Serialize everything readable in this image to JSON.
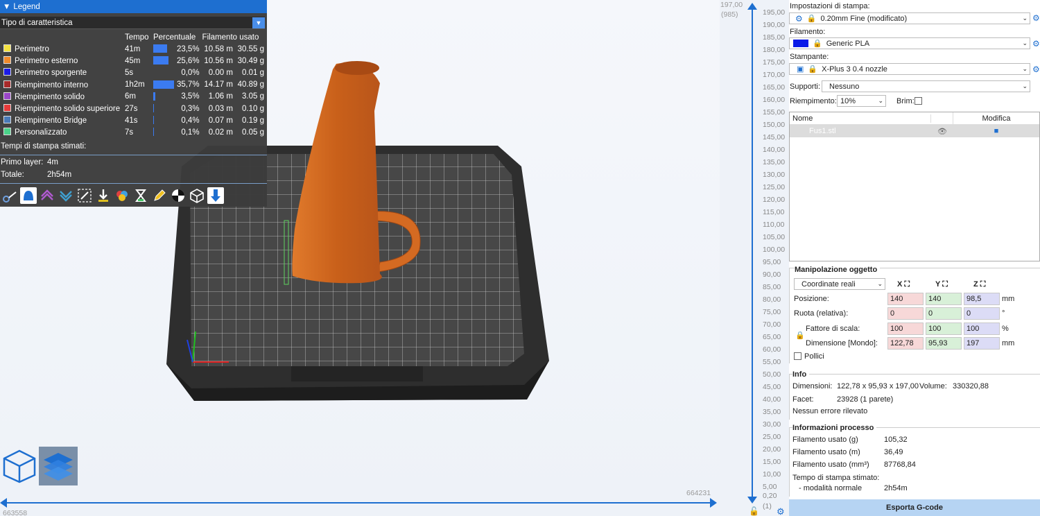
{
  "legend": {
    "title": "Legend",
    "combo": "Tipo di caratteristica",
    "headers": [
      "",
      "Tempo",
      "Percentuale",
      "Filamento usato"
    ],
    "rows": [
      {
        "name": "Perimetro",
        "color": "#f4e241",
        "time": "41m",
        "pct": "23,5%",
        "pct_value": 23.5,
        "m": "10.58 m",
        "g": "30.55 g"
      },
      {
        "name": "Perimetro esterno",
        "color": "#f08a2b",
        "time": "45m",
        "pct": "25,6%",
        "pct_value": 25.6,
        "m": "10.56 m",
        "g": "30.49 g"
      },
      {
        "name": "Perimetro sporgente",
        "color": "#1c1ce6",
        "time": "5s",
        "pct": "0,0%",
        "pct_value": 0,
        "m": "0.00 m",
        "g": "0.01 g"
      },
      {
        "name": "Riempimento interno",
        "color": "#a82a2a",
        "time": "1h2m",
        "pct": "35,7%",
        "pct_value": 35.7,
        "m": "14.17 m",
        "g": "40.89 g"
      },
      {
        "name": "Riempimento solido",
        "color": "#9a46c8",
        "time": "6m",
        "pct": "3,5%",
        "pct_value": 3.5,
        "m": "1.06 m",
        "g": "3.05 g"
      },
      {
        "name": "Riempimento solido superiore",
        "color": "#e63a3a",
        "time": "27s",
        "pct": "0,3%",
        "pct_value": 0.3,
        "m": "0.03 m",
        "g": "0.10 g"
      },
      {
        "name": "Riempimento Bridge",
        "color": "#4a7ab8",
        "time": "41s",
        "pct": "0,4%",
        "pct_value": 0.4,
        "m": "0.07 m",
        "g": "0.19 g"
      },
      {
        "name": "Personalizzato",
        "color": "#4bd38a",
        "time": "7s",
        "pct": "0,1%",
        "pct_value": 0.1,
        "m": "0.02 m",
        "g": "0.05 g"
      }
    ],
    "times_title": "Tempi di stampa stimati:",
    "first_layer_label": "Primo layer:",
    "first_layer": "4m",
    "total_label": "Totale:",
    "total": "2h54m"
  },
  "viewport": {
    "top_left_value": "197,00",
    "top_left_sub": "(985)",
    "bottom_left": "663558",
    "bottom_right": "664231"
  },
  "ruler": {
    "ticks": [
      "195,00",
      "190,00",
      "185,00",
      "180,00",
      "175,00",
      "170,00",
      "165,00",
      "160,00",
      "155,00",
      "150,00",
      "145,00",
      "140,00",
      "135,00",
      "130,00",
      "125,00",
      "120,00",
      "115,00",
      "110,00",
      "105,00",
      "100,00",
      "95,00",
      "90,00",
      "85,00",
      "80,00",
      "75,00",
      "70,00",
      "65,00",
      "60,00",
      "55,00",
      "50,00",
      "45,00",
      "40,00",
      "35,00",
      "30,00",
      "25,00",
      "20,00",
      "15,00",
      "10,00",
      "5,00"
    ],
    "bottom": "0,20",
    "bottom_sub": "(1)"
  },
  "panel": {
    "print_settings_label": "Impostazioni di stampa:",
    "print_settings": "0.20mm Fine (modificato)",
    "filament_label": "Filamento:",
    "filament": "Generic PLA",
    "filament_color": "#0a1ae8",
    "printer_label": "Stampante:",
    "printer": "X-Plus 3 0.4 nozzle",
    "supports_label": "Supporti:",
    "supports": "Nessuno",
    "infill_label": "Riempimento:",
    "infill": "10%",
    "brim_label": "Brim:",
    "list_name_header": "Nome",
    "list_edit_header": "Modifica",
    "object_name": "Fus1.stl",
    "manip_title": "Manipolazione oggetto",
    "coord_mode": "Coordinate reali",
    "axes": [
      "X",
      "Y",
      "Z"
    ],
    "position_label": "Posizione:",
    "position": [
      "140",
      "140",
      "98,5"
    ],
    "position_unit": "mm",
    "rotate_label": "Ruota (relativa):",
    "rotate": [
      "0",
      "0",
      "0"
    ],
    "rotate_unit": "°",
    "scale_label": "Fattore di scala:",
    "scale": [
      "100",
      "100",
      "100"
    ],
    "scale_unit": "%",
    "size_label": "Dimensione [Mondo]:",
    "size": [
      "122,78",
      "95,93",
      "197"
    ],
    "size_unit": "mm",
    "inches_label": "Pollici",
    "info_title": "Info",
    "dimensions_label": "Dimensioni:",
    "dimensions": "122,78 x 95,93 x 197,00",
    "volume_label": "Volume:",
    "volume": "330320,88",
    "facets_label": "Facet:",
    "facets": "23928 (1 parete)",
    "errors": "Nessun errore rilevato",
    "process_title": "Informazioni processo",
    "fil_g_label": "Filamento usato (g)",
    "fil_g": "105,32",
    "fil_m_label": "Filamento usato (m)",
    "fil_m": "36,49",
    "fil_mm3_label": "Filamento usato (mm³)",
    "fil_mm3": "87768,84",
    "time_label": "Tempo di stampa stimato:",
    "mode_label": "- modalità normale",
    "mode_time": "2h54m",
    "export": "Esporta G-code"
  },
  "colors": {
    "accent": "#1e6fd0",
    "model": "#d5661f",
    "bed": "#2e2e2e"
  }
}
